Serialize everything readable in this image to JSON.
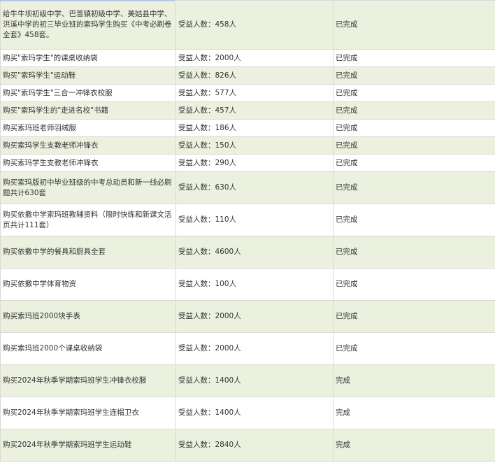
{
  "rows": [
    {
      "item": "给牛牛坝初级中学、巴普镇初级中学、美姑县中学、洪溪中学的初三毕业班的索玛学生购买《中考必刷卷全套》458套。",
      "beneficiaries": "受益人数：458人",
      "status": "已完成"
    },
    {
      "item": "购买\"索玛学生\"的课桌收纳袋",
      "beneficiaries": "受益人数：2000人",
      "status": "已完成"
    },
    {
      "item": "购买\"索玛学生\"运动鞋",
      "beneficiaries": "受益人数：826人",
      "status": "已完成"
    },
    {
      "item": "购买\"索玛学生\"三合一冲锋衣校服",
      "beneficiaries": "受益人数：577人",
      "status": "已完成"
    },
    {
      "item": "购买\"索玛学生的\"走进名校\"书籍",
      "beneficiaries": "受益人数：457人",
      "status": "已完成"
    },
    {
      "item": "购买索玛班老师羽绒服",
      "beneficiaries": "受益人数：186人",
      "status": "已完成"
    },
    {
      "item": "购买索玛学生支教老师冲锋衣",
      "beneficiaries": "受益人数：150人",
      "status": "已完成"
    },
    {
      "item": "购买索玛学生支教老师冲锋衣",
      "beneficiaries": "受益人数：290人",
      "status": "已完成"
    },
    {
      "item": "购买索玛版初中毕业班级的中考总动员和新一线必刷题共计630套",
      "beneficiaries": "受益人数：630人",
      "status": "已完成"
    },
    {
      "item": "购买依撒中学索玛班教辅资料（限时快练和新课文活页共计111套）",
      "beneficiaries": "受益人数：110人",
      "status": "已完成"
    },
    {
      "item": "购买依撒中学的餐具和厨具全套",
      "beneficiaries": "受益人数：4600人",
      "status": "已完成"
    },
    {
      "item": "购买依撒中学体育物资",
      "beneficiaries": "受益人数：100人",
      "status": "已完成"
    },
    {
      "item": "购买索玛班2000块手表",
      "beneficiaries": "受益人数：2000人",
      "status": "已完成"
    },
    {
      "item": "购买索玛班2000个课桌收纳袋",
      "beneficiaries": "受益人数：2000人",
      "status": "已完成"
    },
    {
      "item": "购买2024年秋季学期索玛班学生冲锋衣校服",
      "beneficiaries": "受益人数：1400人",
      "status": "完成"
    },
    {
      "item": "购买2024年秋季学期索玛班学生连帽卫衣",
      "beneficiaries": "受益人数：1400人",
      "status": "完成"
    },
    {
      "item": "购买2024年秋季学期索玛班学生运动鞋",
      "beneficiaries": "受益人数：2840人",
      "status": "完成"
    }
  ]
}
